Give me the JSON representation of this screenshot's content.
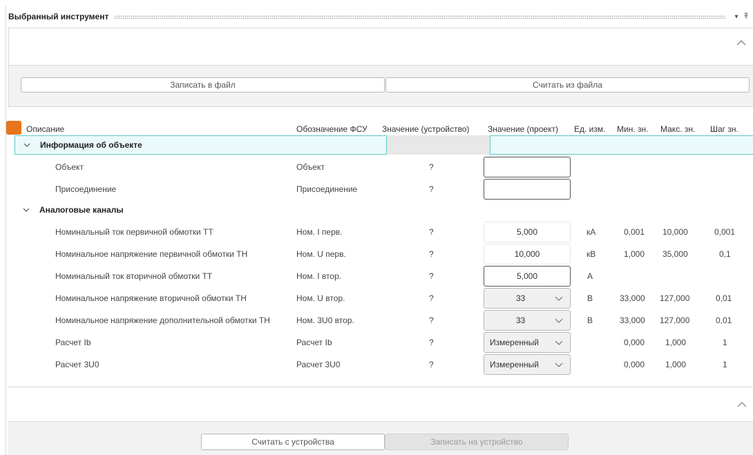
{
  "window": {
    "title": "Выбранный инструмент",
    "menu_icon": "dropdown-arrow-icon",
    "pin_icon": "pin-icon"
  },
  "file_buttons": {
    "write_file": "Записать в файл",
    "read_file": "Считать из файла"
  },
  "table": {
    "headers": {
      "description": "Описание",
      "fsu": "Обозначение ФСУ",
      "value_device": "Значение (устройство)",
      "value_project": "Значение (проект)",
      "unit": "Ед. изм.",
      "min": "Мин. зн.",
      "max": "Макс. зн.",
      "step": "Шаг зн."
    },
    "groups": [
      {
        "label": "Информация об объекте",
        "rows": [
          {
            "desc": "Объект",
            "fsu": "Объект",
            "device": "?",
            "project": "",
            "unit": "",
            "min": "",
            "max": "",
            "step": ""
          },
          {
            "desc": "Присоединение",
            "fsu": "Присоединение",
            "device": "?",
            "project": "",
            "unit": "",
            "min": "",
            "max": "",
            "step": ""
          }
        ]
      },
      {
        "label": "Аналоговые каналы",
        "rows": [
          {
            "desc": "Номинальный ток первичной обмотки ТТ",
            "fsu": "Ном. I перв.",
            "device": "?",
            "project": "5,000",
            "unit": "кА",
            "min": "0,001",
            "max": "10,000",
            "step": "0,001"
          },
          {
            "desc": "Номинальное напряжение первичной обмотки ТН",
            "fsu": "Ном. U перв.",
            "device": "?",
            "project": "10,000",
            "unit": "кВ",
            "min": "1,000",
            "max": "35,000",
            "step": "0,1"
          },
          {
            "desc": "Номинальный ток вторичной обмотки ТТ",
            "fsu": "Ном. I втор.",
            "device": "?",
            "project": "5,000",
            "unit": "А",
            "min": "",
            "max": "",
            "step": ""
          },
          {
            "desc": "Номинальное напряжение вторичной обмотки ТН",
            "fsu": "Ном. U втор.",
            "device": "?",
            "project": "33",
            "unit": "В",
            "min": "33,000",
            "max": "127,000",
            "step": "0,01"
          },
          {
            "desc": "Номинальное напряжение дополнительной обмотки ТН",
            "fsu": "Ном. 3U0 втор.",
            "device": "?",
            "project": "33",
            "unit": "В",
            "min": "33,000",
            "max": "127,000",
            "step": "0,01"
          },
          {
            "desc": "Расчет Ib",
            "fsu": "Расчет Ib",
            "device": "?",
            "project": "Измеренный",
            "unit": "",
            "min": "0,000",
            "max": "1,000",
            "step": "1"
          },
          {
            "desc": "Расчет 3U0",
            "fsu": "Расчет 3U0",
            "device": "?",
            "project": "Измеренный",
            "unit": "",
            "min": "0,000",
            "max": "1,000",
            "step": "1"
          }
        ]
      }
    ]
  },
  "device_buttons": {
    "read_device": "Считать с устройства",
    "write_device": "Записать на устройство"
  },
  "colors": {
    "accent_orange": "#e8741b",
    "selection_border": "#5fc8c8",
    "selection_bg": "#eafafa"
  }
}
